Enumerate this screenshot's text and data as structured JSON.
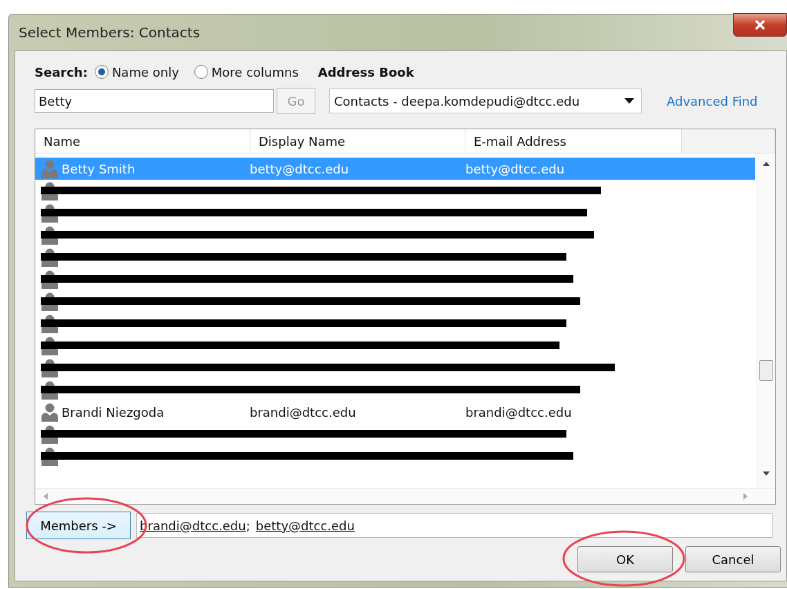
{
  "window": {
    "title": "Select Members: Contacts"
  },
  "search": {
    "label": "Search:",
    "options": [
      {
        "label": "Name only",
        "selected": true
      },
      {
        "label": "More columns",
        "selected": false
      }
    ],
    "value": "Betty",
    "go_button": "Go"
  },
  "address_book": {
    "label": "Address Book",
    "value": "Contacts - deepa.komdepudi@dtcc.edu",
    "advanced_find": "Advanced Find"
  },
  "table": {
    "columns": [
      "Name",
      "Display Name",
      "E-mail Address"
    ],
    "rows": [
      {
        "kind": "contact",
        "name": "Betty Smith",
        "display_name": "betty@dtcc.edu",
        "email": "betty@dtcc.edu",
        "selected": true
      },
      {
        "kind": "redacted",
        "selected": false
      },
      {
        "kind": "redacted",
        "selected": false
      },
      {
        "kind": "redacted",
        "selected": false
      },
      {
        "kind": "redacted",
        "selected": false
      },
      {
        "kind": "redacted",
        "selected": false
      },
      {
        "kind": "redacted",
        "selected": false
      },
      {
        "kind": "redacted",
        "selected": false
      },
      {
        "kind": "redacted",
        "selected": false
      },
      {
        "kind": "redacted",
        "selected": false
      },
      {
        "kind": "redacted",
        "selected": false
      },
      {
        "kind": "contact",
        "name": "Brandi Niezgoda",
        "display_name": "brandi@dtcc.edu",
        "email": "brandi@dtcc.edu",
        "selected": false
      },
      {
        "kind": "redacted",
        "selected": false
      },
      {
        "kind": "redacted",
        "selected": false
      }
    ]
  },
  "members": {
    "button": "Members ->",
    "recipients": [
      "brandi@dtcc.edu",
      "betty@dtcc.edu"
    ],
    "separator": ";"
  },
  "buttons": [
    "OK",
    "Cancel"
  ]
}
